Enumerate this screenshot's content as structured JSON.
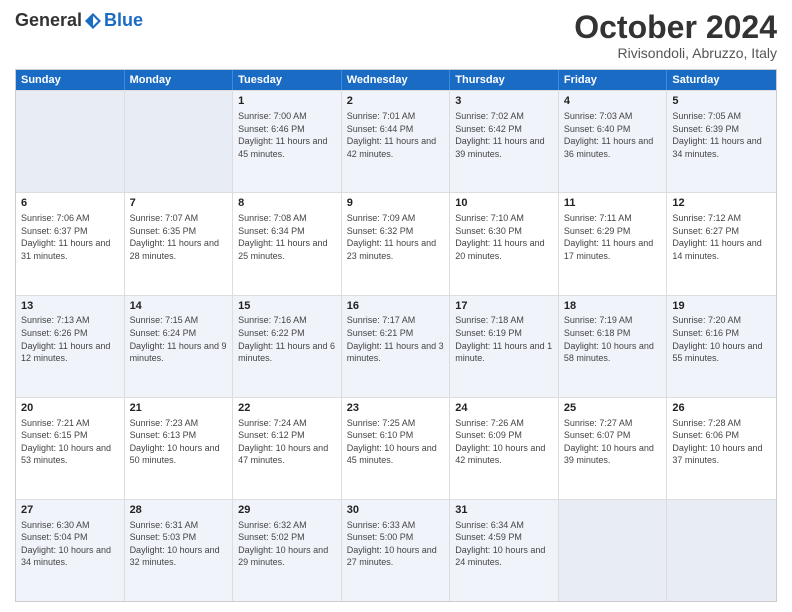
{
  "logo": {
    "general": "General",
    "blue": "Blue"
  },
  "title": "October 2024",
  "location": "Rivisondoli, Abruzzo, Italy",
  "weekdays": [
    "Sunday",
    "Monday",
    "Tuesday",
    "Wednesday",
    "Thursday",
    "Friday",
    "Saturday"
  ],
  "rows": [
    [
      {
        "day": "",
        "info": ""
      },
      {
        "day": "",
        "info": ""
      },
      {
        "day": "1",
        "info": "Sunrise: 7:00 AM\nSunset: 6:46 PM\nDaylight: 11 hours and 45 minutes."
      },
      {
        "day": "2",
        "info": "Sunrise: 7:01 AM\nSunset: 6:44 PM\nDaylight: 11 hours and 42 minutes."
      },
      {
        "day": "3",
        "info": "Sunrise: 7:02 AM\nSunset: 6:42 PM\nDaylight: 11 hours and 39 minutes."
      },
      {
        "day": "4",
        "info": "Sunrise: 7:03 AM\nSunset: 6:40 PM\nDaylight: 11 hours and 36 minutes."
      },
      {
        "day": "5",
        "info": "Sunrise: 7:05 AM\nSunset: 6:39 PM\nDaylight: 11 hours and 34 minutes."
      }
    ],
    [
      {
        "day": "6",
        "info": "Sunrise: 7:06 AM\nSunset: 6:37 PM\nDaylight: 11 hours and 31 minutes."
      },
      {
        "day": "7",
        "info": "Sunrise: 7:07 AM\nSunset: 6:35 PM\nDaylight: 11 hours and 28 minutes."
      },
      {
        "day": "8",
        "info": "Sunrise: 7:08 AM\nSunset: 6:34 PM\nDaylight: 11 hours and 25 minutes."
      },
      {
        "day": "9",
        "info": "Sunrise: 7:09 AM\nSunset: 6:32 PM\nDaylight: 11 hours and 23 minutes."
      },
      {
        "day": "10",
        "info": "Sunrise: 7:10 AM\nSunset: 6:30 PM\nDaylight: 11 hours and 20 minutes."
      },
      {
        "day": "11",
        "info": "Sunrise: 7:11 AM\nSunset: 6:29 PM\nDaylight: 11 hours and 17 minutes."
      },
      {
        "day": "12",
        "info": "Sunrise: 7:12 AM\nSunset: 6:27 PM\nDaylight: 11 hours and 14 minutes."
      }
    ],
    [
      {
        "day": "13",
        "info": "Sunrise: 7:13 AM\nSunset: 6:26 PM\nDaylight: 11 hours and 12 minutes."
      },
      {
        "day": "14",
        "info": "Sunrise: 7:15 AM\nSunset: 6:24 PM\nDaylight: 11 hours and 9 minutes."
      },
      {
        "day": "15",
        "info": "Sunrise: 7:16 AM\nSunset: 6:22 PM\nDaylight: 11 hours and 6 minutes."
      },
      {
        "day": "16",
        "info": "Sunrise: 7:17 AM\nSunset: 6:21 PM\nDaylight: 11 hours and 3 minutes."
      },
      {
        "day": "17",
        "info": "Sunrise: 7:18 AM\nSunset: 6:19 PM\nDaylight: 11 hours and 1 minute."
      },
      {
        "day": "18",
        "info": "Sunrise: 7:19 AM\nSunset: 6:18 PM\nDaylight: 10 hours and 58 minutes."
      },
      {
        "day": "19",
        "info": "Sunrise: 7:20 AM\nSunset: 6:16 PM\nDaylight: 10 hours and 55 minutes."
      }
    ],
    [
      {
        "day": "20",
        "info": "Sunrise: 7:21 AM\nSunset: 6:15 PM\nDaylight: 10 hours and 53 minutes."
      },
      {
        "day": "21",
        "info": "Sunrise: 7:23 AM\nSunset: 6:13 PM\nDaylight: 10 hours and 50 minutes."
      },
      {
        "day": "22",
        "info": "Sunrise: 7:24 AM\nSunset: 6:12 PM\nDaylight: 10 hours and 47 minutes."
      },
      {
        "day": "23",
        "info": "Sunrise: 7:25 AM\nSunset: 6:10 PM\nDaylight: 10 hours and 45 minutes."
      },
      {
        "day": "24",
        "info": "Sunrise: 7:26 AM\nSunset: 6:09 PM\nDaylight: 10 hours and 42 minutes."
      },
      {
        "day": "25",
        "info": "Sunrise: 7:27 AM\nSunset: 6:07 PM\nDaylight: 10 hours and 39 minutes."
      },
      {
        "day": "26",
        "info": "Sunrise: 7:28 AM\nSunset: 6:06 PM\nDaylight: 10 hours and 37 minutes."
      }
    ],
    [
      {
        "day": "27",
        "info": "Sunrise: 6:30 AM\nSunset: 5:04 PM\nDaylight: 10 hours and 34 minutes."
      },
      {
        "day": "28",
        "info": "Sunrise: 6:31 AM\nSunset: 5:03 PM\nDaylight: 10 hours and 32 minutes."
      },
      {
        "day": "29",
        "info": "Sunrise: 6:32 AM\nSunset: 5:02 PM\nDaylight: 10 hours and 29 minutes."
      },
      {
        "day": "30",
        "info": "Sunrise: 6:33 AM\nSunset: 5:00 PM\nDaylight: 10 hours and 27 minutes."
      },
      {
        "day": "31",
        "info": "Sunrise: 6:34 AM\nSunset: 4:59 PM\nDaylight: 10 hours and 24 minutes."
      },
      {
        "day": "",
        "info": ""
      },
      {
        "day": "",
        "info": ""
      }
    ]
  ],
  "alt_rows": [
    0,
    2,
    4
  ]
}
